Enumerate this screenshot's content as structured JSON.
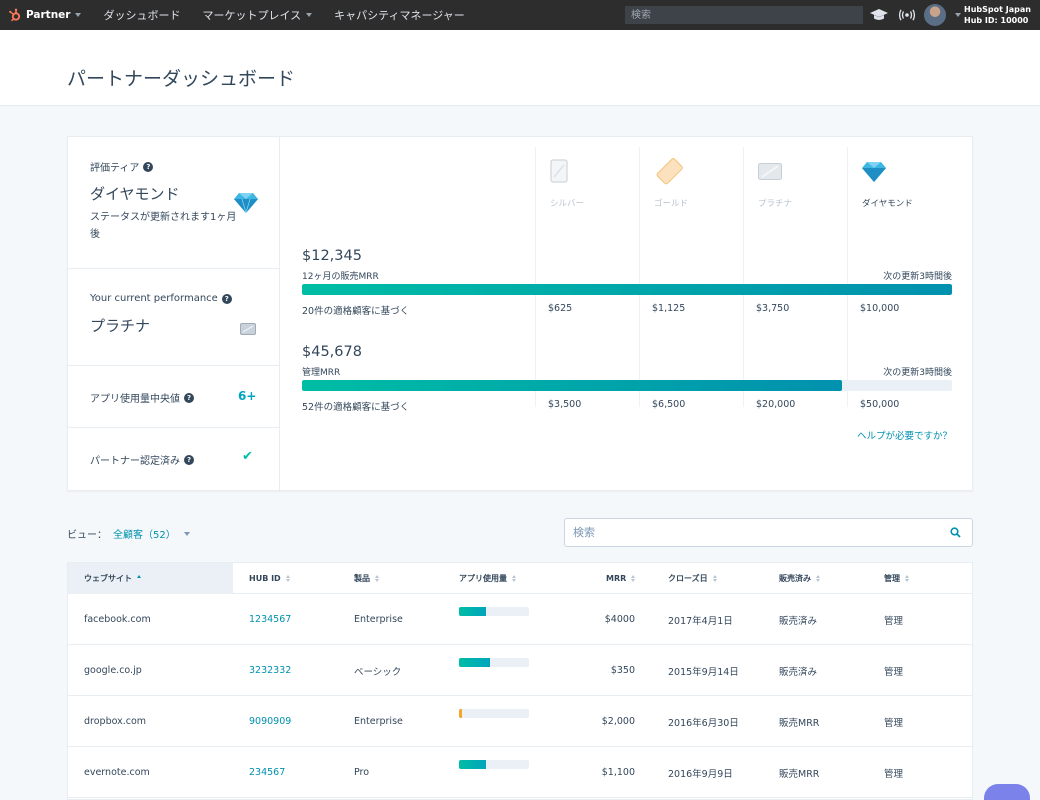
{
  "nav": {
    "brand": "Partner",
    "links": [
      "ダッシュボード",
      "マーケットプレイス",
      "キャパシティマネージャー"
    ],
    "search_placeholder": "検索",
    "account_name": "HubSpot Japan",
    "account_hub": "Hub ID: 10000"
  },
  "page": {
    "title": "パートナーダッシュボード"
  },
  "tiers_panel": {
    "rating_label": "評価ティア",
    "rating_value": "ダイヤモンド",
    "rating_note": "ステータスが更新されます1ヶ月後",
    "performance_label": "Your current performance",
    "performance_value": "プラチナ",
    "app_usage_label": "アプリ使用量中央値",
    "app_usage_value": "6+",
    "certified_label": "パートナー認定済み",
    "tier_names": [
      "シルバー",
      "ゴールド",
      "プラチナ",
      "ダイヤモンド"
    ]
  },
  "metrics": [
    {
      "amount": "$12,345",
      "label": "12ヶ月の販売MRR",
      "next_update": "次の更新3時間後",
      "progress": 1.0,
      "basis": "20件の適格顧客に基づく",
      "thresholds": [
        "$625",
        "$1,125",
        "$3,750",
        "$10,000"
      ]
    },
    {
      "amount": "$45,678",
      "label": "管理MRR",
      "next_update": "次の更新3時間後",
      "progress": 0.83,
      "basis": "52件の適格顧客に基づく",
      "thresholds": [
        "$3,500",
        "$6,500",
        "$20,000",
        "$50,000"
      ]
    }
  ],
  "help_link": "ヘルプが必要ですか？",
  "view": {
    "label": "ビュー：",
    "selected": "全顧客（52）"
  },
  "table_search_placeholder": "検索",
  "table": {
    "headers": [
      "ウェブサイト",
      "HUB ID",
      "製品",
      "アプリ使用量",
      "MRR",
      "クローズ日",
      "販売済み",
      "管理"
    ],
    "rows": [
      {
        "website": "facebook.com",
        "hub_id": "1234567",
        "product": "Enterprise",
        "usage": 0.38,
        "mrr": "$4000",
        "close_date": "2017年4月1日",
        "sold": "販売済み",
        "manage": "管理"
      },
      {
        "website": "google.co.jp",
        "hub_id": "3232332",
        "product": "ベーシック",
        "usage": 0.44,
        "mrr": "$350",
        "close_date": "2015年9月14日",
        "sold": "販売済み",
        "manage": "管理"
      },
      {
        "website": "dropbox.com",
        "hub_id": "9090909",
        "product": "Enterprise",
        "usage": 0.04,
        "usage_color": "#f5a623",
        "mrr": "$2,000",
        "close_date": "2016年6月30日",
        "sold": "販売MRR",
        "manage": "管理"
      },
      {
        "website": "evernote.com",
        "hub_id": "234567",
        "product": "Pro",
        "usage": 0.38,
        "mrr": "$1,100",
        "close_date": "2016年9月9日",
        "sold": "販売MRR",
        "manage": "管理"
      }
    ]
  },
  "colors": {
    "teal": "#00a4bd",
    "accent_green": "#00bda5",
    "nav_bg": "#2d2d2d",
    "orange": "#f5a623"
  }
}
